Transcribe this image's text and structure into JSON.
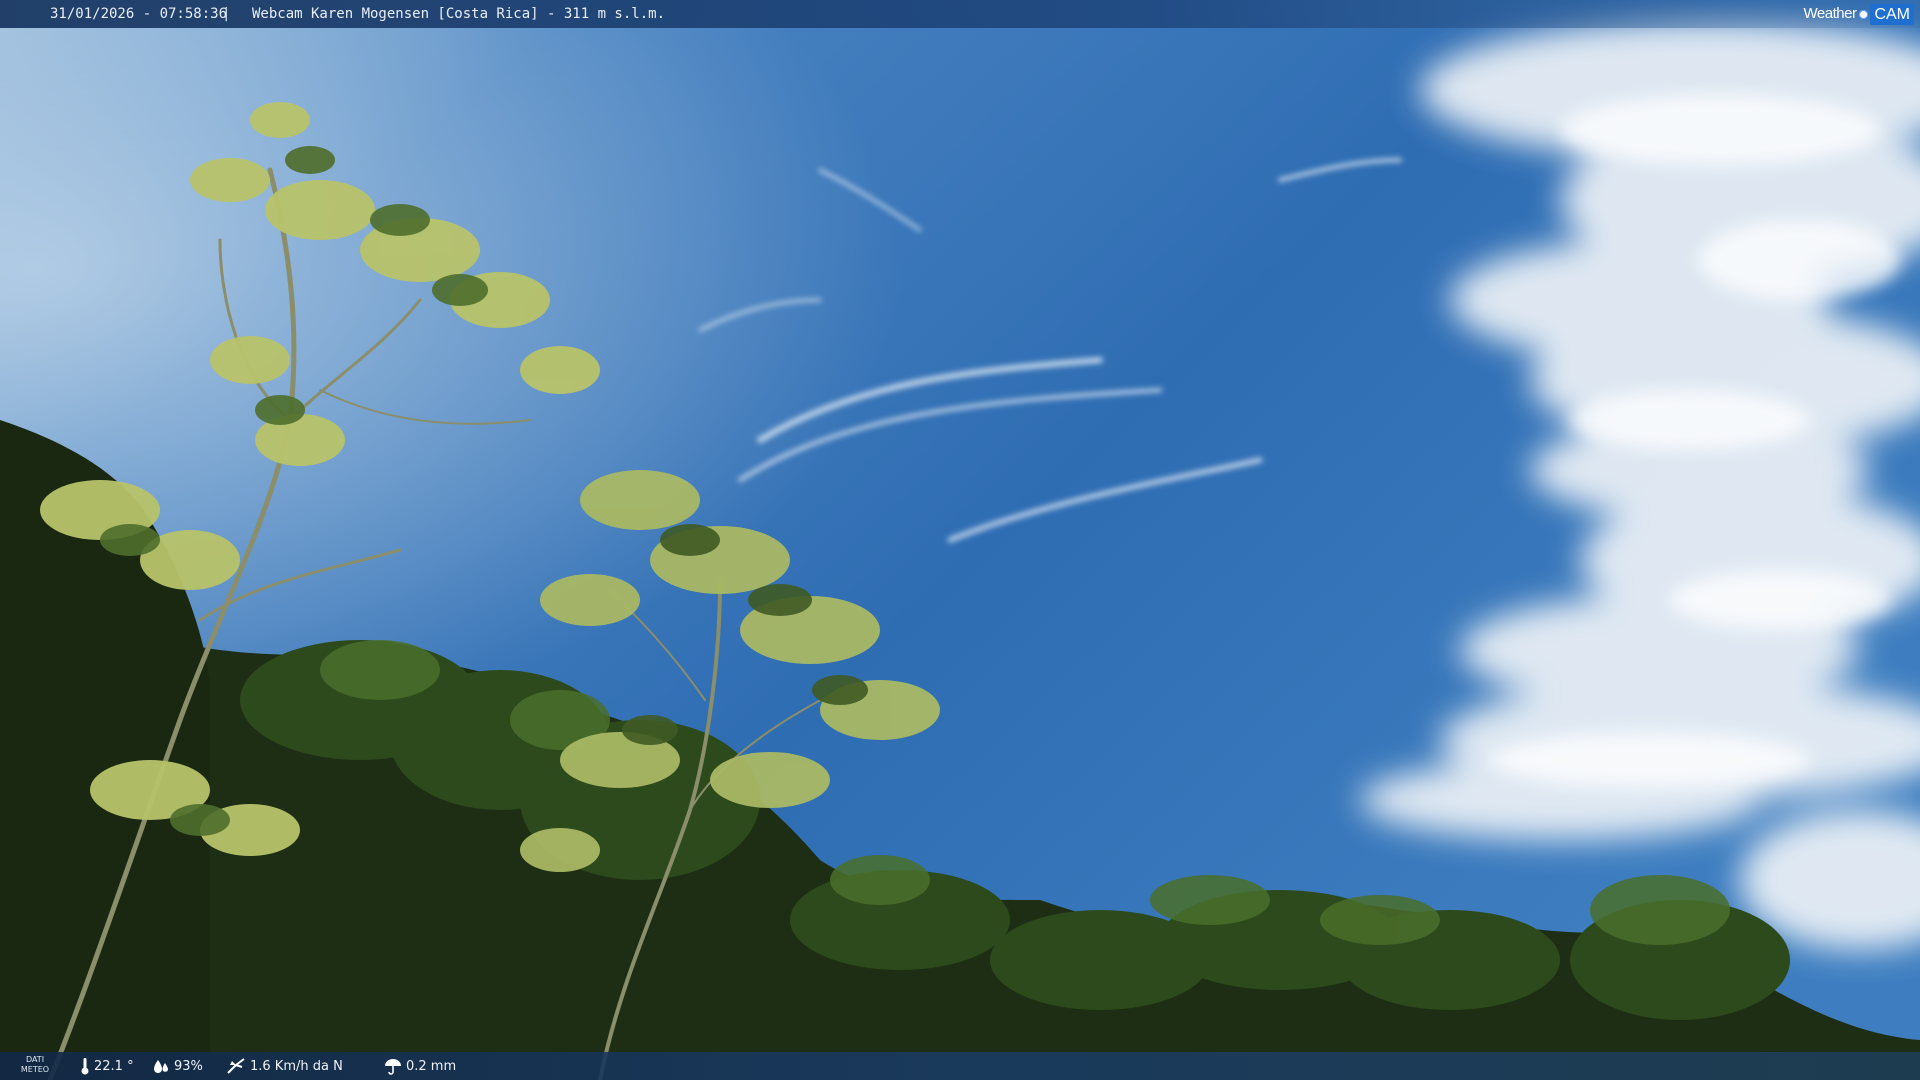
{
  "header": {
    "timestamp": "31/01/2026 - 07:58:36",
    "separator": "|",
    "camera_title": "Webcam Karen Mogensen [Costa Rica] - 311 m s.l.m."
  },
  "logo": {
    "word1": "Weather",
    "word2": "CAM",
    "accent_color": "#1e6fd0"
  },
  "weather": {
    "panel_label_line1": "DATI",
    "panel_label_line2": "METEO",
    "temperature": "22.1 °",
    "humidity": "93%",
    "wind": "1.6 Km/h da N",
    "rain": "0.2 mm",
    "icons": [
      "thermometer-icon",
      "humidity-drops-icon",
      "wind-vane-icon",
      "rain-umbrella-icon"
    ]
  },
  "scene": {
    "sky_colors": [
      "#2e6fb7",
      "#4a86c6",
      "#8fb8de"
    ],
    "foliage_colors": [
      "#1c2a12",
      "#2d4a1c",
      "#4f7a2a",
      "#b9c86a"
    ]
  }
}
